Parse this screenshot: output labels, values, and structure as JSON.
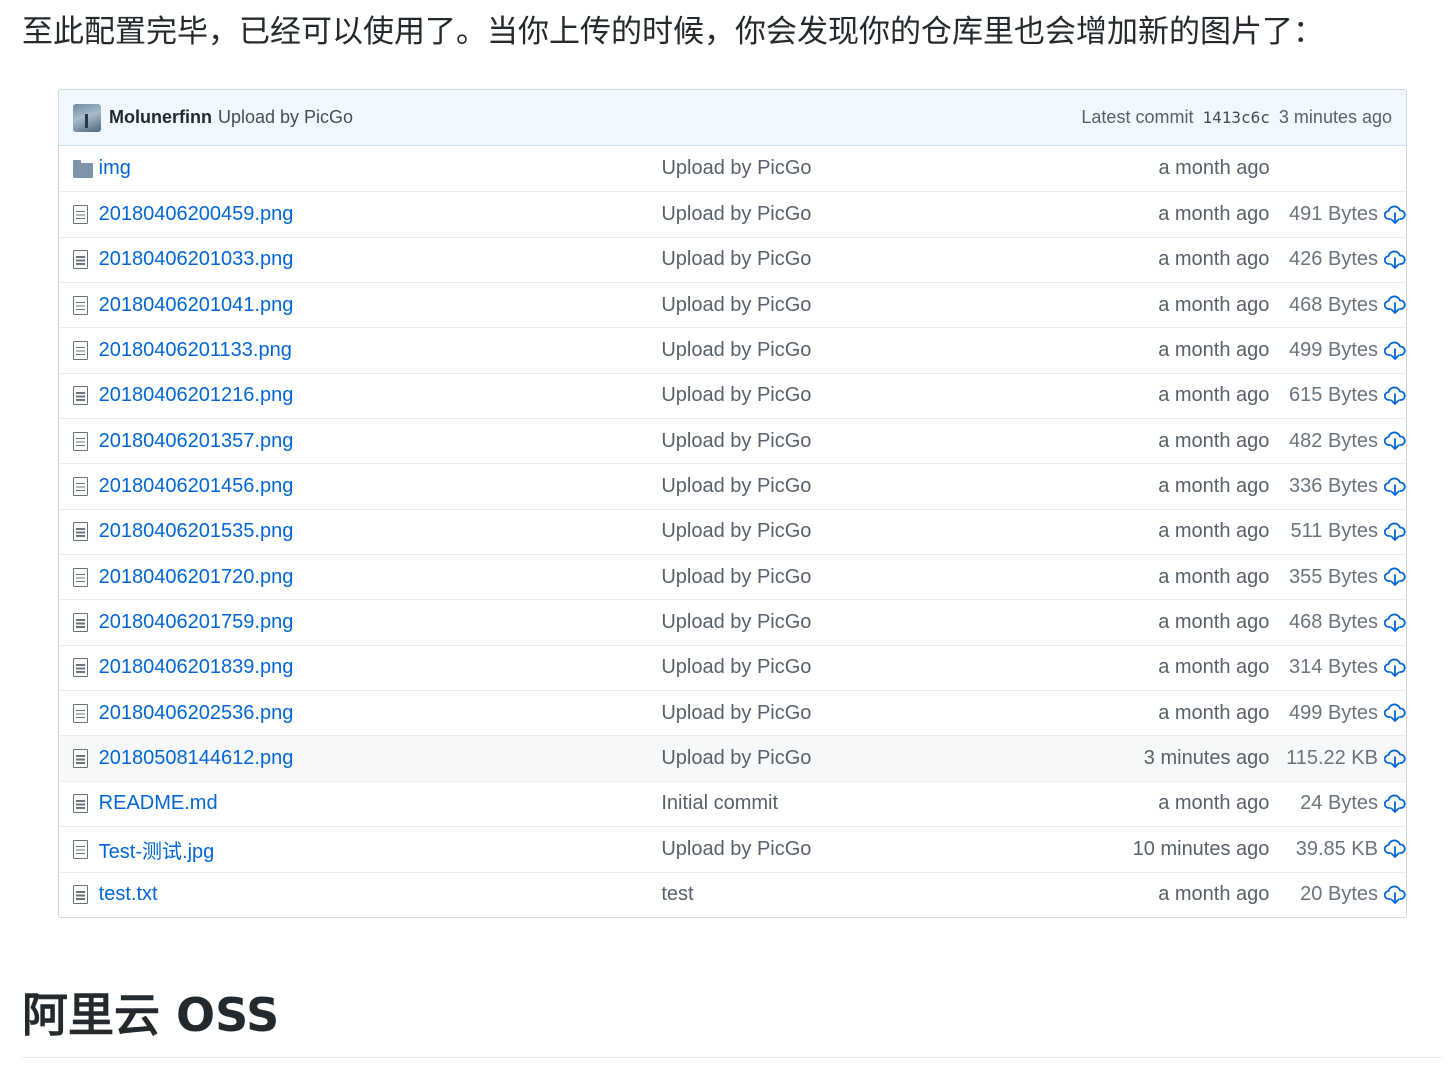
{
  "intro_text": "至此配置完毕，已经可以使用了。当你上传的时候，你会发现你的仓库里也会增加新的图片了：",
  "commit_bar": {
    "author": "Molunerfinn",
    "message": "Upload by PicGo",
    "latest_label": "Latest commit",
    "sha": "1413c6c",
    "age": "3 minutes ago"
  },
  "files": [
    {
      "name": "img",
      "type": "folder",
      "message": "Upload by PicGo",
      "age": "a month ago",
      "size": ""
    },
    {
      "name": "20180406200459.png",
      "type": "file",
      "message": "Upload by PicGo",
      "age": "a month ago",
      "size": "491 Bytes"
    },
    {
      "name": "20180406201033.png",
      "type": "file",
      "message": "Upload by PicGo",
      "age": "a month ago",
      "size": "426 Bytes"
    },
    {
      "name": "20180406201041.png",
      "type": "file",
      "message": "Upload by PicGo",
      "age": "a month ago",
      "size": "468 Bytes"
    },
    {
      "name": "20180406201133.png",
      "type": "file",
      "message": "Upload by PicGo",
      "age": "a month ago",
      "size": "499 Bytes"
    },
    {
      "name": "20180406201216.png",
      "type": "file",
      "message": "Upload by PicGo",
      "age": "a month ago",
      "size": "615 Bytes"
    },
    {
      "name": "20180406201357.png",
      "type": "file",
      "message": "Upload by PicGo",
      "age": "a month ago",
      "size": "482 Bytes"
    },
    {
      "name": "20180406201456.png",
      "type": "file",
      "message": "Upload by PicGo",
      "age": "a month ago",
      "size": "336 Bytes"
    },
    {
      "name": "20180406201535.png",
      "type": "file",
      "message": "Upload by PicGo",
      "age": "a month ago",
      "size": "511 Bytes"
    },
    {
      "name": "20180406201720.png",
      "type": "file",
      "message": "Upload by PicGo",
      "age": "a month ago",
      "size": "355 Bytes"
    },
    {
      "name": "20180406201759.png",
      "type": "file",
      "message": "Upload by PicGo",
      "age": "a month ago",
      "size": "468 Bytes"
    },
    {
      "name": "20180406201839.png",
      "type": "file",
      "message": "Upload by PicGo",
      "age": "a month ago",
      "size": "314 Bytes"
    },
    {
      "name": "20180406202536.png",
      "type": "file",
      "message": "Upload by PicGo",
      "age": "a month ago",
      "size": "499 Bytes"
    },
    {
      "name": "20180508144612.png",
      "type": "file",
      "message": "Upload by PicGo",
      "age": "3 minutes ago",
      "size": "115.22 KB",
      "highlight": true
    },
    {
      "name": "README.md",
      "type": "file",
      "message": "Initial commit",
      "age": "a month ago",
      "size": "24 Bytes"
    },
    {
      "name": "Test-测试.jpg",
      "type": "file",
      "message": "Upload by PicGo",
      "age": "10 minutes ago",
      "size": "39.85 KB"
    },
    {
      "name": "test.txt",
      "type": "file",
      "message": "test",
      "age": "a month ago",
      "size": "20 Bytes"
    }
  ],
  "icons": {
    "folder": "folder-icon",
    "file": "file-icon",
    "download": "cloud-download-icon"
  },
  "colors": {
    "link": "#0366d6",
    "commit_bar_bg": "#f1f8ff",
    "muted": "#586069",
    "download_icon": "#0366d6"
  },
  "heading": "阿里云 OSS"
}
